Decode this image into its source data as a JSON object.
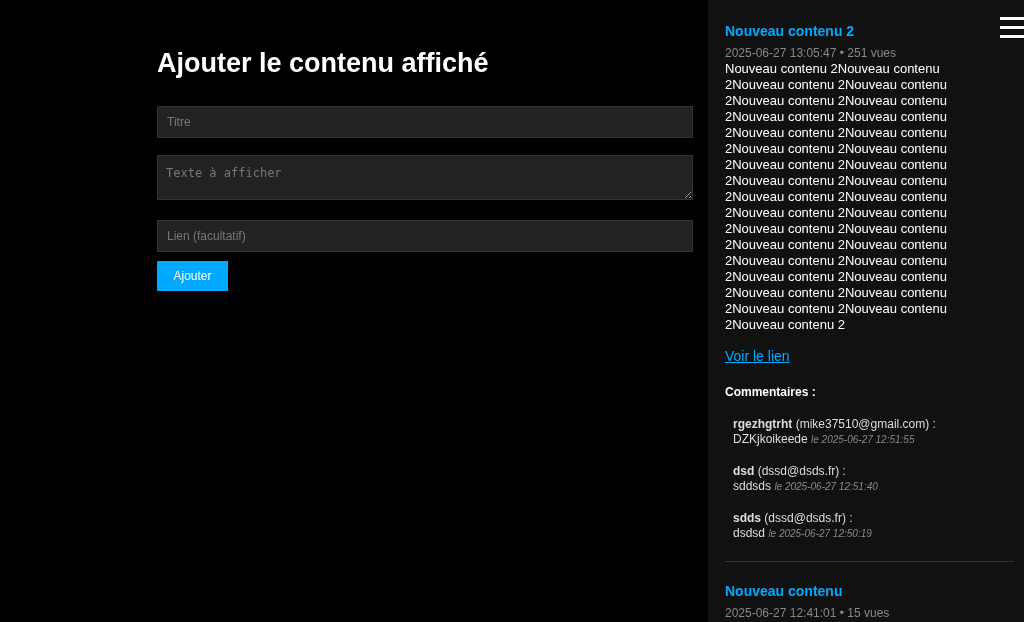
{
  "form": {
    "title": "Ajouter le contenu affiché",
    "fields": [
      {
        "kind": "input",
        "placeholder": "Titre"
      },
      {
        "kind": "textarea",
        "placeholder": "Texte à afficher"
      },
      {
        "kind": "input",
        "placeholder": "Lien (facultatif)"
      }
    ],
    "submit": "Ajouter"
  },
  "sidebar": {
    "posts": [
      {
        "title": "Nouveau contenu 2",
        "meta": "2025-06-27 13:05:47 • 251 vues",
        "body": "Nouveau contenu 2Nouveau contenu 2Nouveau contenu 2Nouveau contenu 2Nouveau contenu 2Nouveau contenu 2Nouveau contenu 2Nouveau contenu 2Nouveau contenu 2Nouveau contenu 2Nouveau contenu 2Nouveau contenu 2Nouveau contenu 2Nouveau contenu 2Nouveau contenu 2Nouveau contenu 2Nouveau contenu 2Nouveau contenu 2Nouveau contenu 2Nouveau contenu 2Nouveau contenu 2Nouveau contenu 2Nouveau contenu 2Nouveau contenu 2Nouveau contenu 2Nouveau contenu 2Nouveau contenu 2Nouveau contenu 2Nouveau contenu 2Nouveau contenu 2Nouveau contenu 2Nouveau contenu 2Nouveau contenu 2",
        "link": "Voir le lien",
        "comments_heading": "Commentaires :",
        "comments": [
          {
            "author": "rgezhgtrht",
            "email": "(mike37510@gmail.com) :",
            "text": "DZKjkoikeede",
            "date": "le 2025-06-27 12:51:55"
          },
          {
            "author": "dsd",
            "email": "(dssd@dsds.fr) :",
            "text": "sddsds",
            "date": "le 2025-06-27 12:51:40"
          },
          {
            "author": "sdds",
            "email": "(dssd@dsds.fr) :",
            "text": "dsdsd",
            "date": "le 2025-06-27 12:50:19"
          }
        ]
      },
      {
        "title": "Nouveau contenu",
        "meta": "2025-06-27 12:41:01 • 15 vues"
      }
    ]
  }
}
